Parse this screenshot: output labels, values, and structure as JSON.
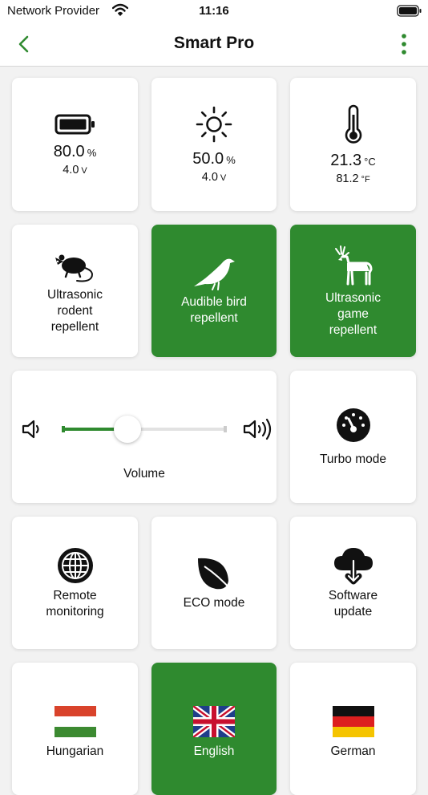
{
  "status_bar": {
    "carrier": "Network Provider",
    "time": "11:16"
  },
  "nav": {
    "title": "Smart Pro"
  },
  "sensors": {
    "battery": {
      "value": "80.0",
      "unit": "%",
      "sub_value": "4.0",
      "sub_unit": "V"
    },
    "solar": {
      "value": "50.0",
      "unit": "%",
      "sub_value": "4.0",
      "sub_unit": "V"
    },
    "temperature": {
      "value": "21.3",
      "unit": "°C",
      "sub_value": "81.2",
      "sub_unit": "°F"
    }
  },
  "modes": {
    "rodent": {
      "label": "Ultrasonic\nrodent\nrepellent",
      "active": false
    },
    "bird": {
      "label": "Audible bird\nrepellent",
      "active": true
    },
    "game": {
      "label": "Ultrasonic\ngame\nrepellent",
      "active": true
    }
  },
  "volume": {
    "label": "Volume",
    "level": 0.4
  },
  "turbo": {
    "label": "Turbo mode"
  },
  "features": {
    "remote": {
      "label": "Remote\nmonitoring"
    },
    "eco": {
      "label": "ECO mode"
    },
    "update": {
      "label": "Software\nupdate"
    }
  },
  "languages": [
    {
      "label": "Hungarian",
      "active": false
    },
    {
      "label": "English",
      "active": true
    },
    {
      "label": "German",
      "active": false
    }
  ],
  "colors": {
    "accent": "#2f8a2f",
    "background": "#f2f2f2",
    "tile": "#ffffff"
  }
}
